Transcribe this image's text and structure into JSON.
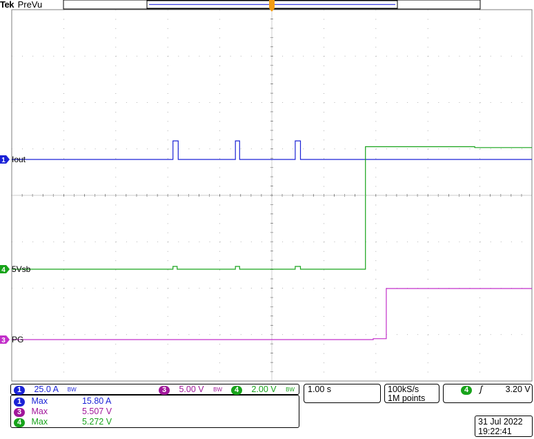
{
  "header": {
    "brand": "Tek",
    "mode": "PreVu"
  },
  "channels": [
    {
      "id": "1",
      "label": "Iout",
      "color": "#1a22d6",
      "scale": "25.0 A",
      "bw_mark": "BW"
    },
    {
      "id": "3",
      "label": "",
      "color": "#a0179a",
      "scale": "5.00 V",
      "bw_mark": "BW"
    },
    {
      "id": "4",
      "label": "5Vsb",
      "color": "#17a31a",
      "scale": "2.00 V",
      "bw_mark": "BW"
    },
    {
      "id": "PG",
      "label": "PG",
      "color": "#c22fc9"
    }
  ],
  "scale_row": {
    "ch1": {
      "num": "1",
      "value": "25.0 A",
      "bw": "BW"
    },
    "ch3": {
      "num": "3",
      "value": "5.00 V",
      "bw": "BW"
    },
    "ch4": {
      "num": "4",
      "value": "2.00 V",
      "bw": "BW"
    }
  },
  "timebase": "1.00 s",
  "acquisition": {
    "rate": "100kS/s",
    "points": "1M points"
  },
  "trigger": {
    "source": "4",
    "slope": "ʃ",
    "level": "3.20 V"
  },
  "measurements": [
    {
      "ch": "1",
      "name": "Max",
      "value": "15.80 A"
    },
    {
      "ch": "3",
      "name": "Max",
      "value": "5.507 V"
    },
    {
      "ch": "4",
      "name": "Max",
      "value": "5.272 V"
    }
  ],
  "datetime": {
    "date": "31 Jul  2022",
    "time": "19:22:41"
  },
  "chart_data": {
    "type": "line",
    "grid": true,
    "x_divisions": 10,
    "y_divisions": 8,
    "time_per_div": "1.00 s",
    "series": [
      {
        "name": "Iout",
        "color": "#1a22d6",
        "points": [
          [
            0,
            0
          ],
          [
            3.1,
            0
          ],
          [
            3.1,
            0.4
          ],
          [
            3.2,
            0.4
          ],
          [
            3.2,
            0
          ],
          [
            4.3,
            0
          ],
          [
            4.3,
            0.4
          ],
          [
            4.38,
            0.4
          ],
          [
            4.38,
            0
          ],
          [
            5.45,
            0
          ],
          [
            5.45,
            0.4
          ],
          [
            5.55,
            0.4
          ],
          [
            5.55,
            0
          ],
          [
            10,
            0
          ]
        ]
      },
      {
        "name": "5Vsb",
        "color": "#17a31a",
        "points": [
          [
            0,
            0
          ],
          [
            3.1,
            0
          ],
          [
            3.1,
            0.06
          ],
          [
            3.18,
            0.06
          ],
          [
            3.18,
            0
          ],
          [
            4.3,
            0
          ],
          [
            4.3,
            0.06
          ],
          [
            4.38,
            0.06
          ],
          [
            4.38,
            0
          ],
          [
            5.45,
            0
          ],
          [
            5.45,
            0.06
          ],
          [
            5.55,
            0.06
          ],
          [
            5.55,
            0
          ],
          [
            6.8,
            0
          ],
          [
            6.8,
            2.64
          ],
          [
            8.9,
            2.64
          ],
          [
            8.9,
            2.62
          ],
          [
            10,
            2.62
          ]
        ]
      },
      {
        "name": "PG",
        "color": "#c22fc9",
        "points": [
          [
            0,
            0
          ],
          [
            6.95,
            0
          ],
          [
            6.95,
            0.02
          ],
          [
            7.2,
            0.02
          ],
          [
            7.2,
            1.1
          ],
          [
            10,
            1.1
          ]
        ]
      }
    ]
  }
}
